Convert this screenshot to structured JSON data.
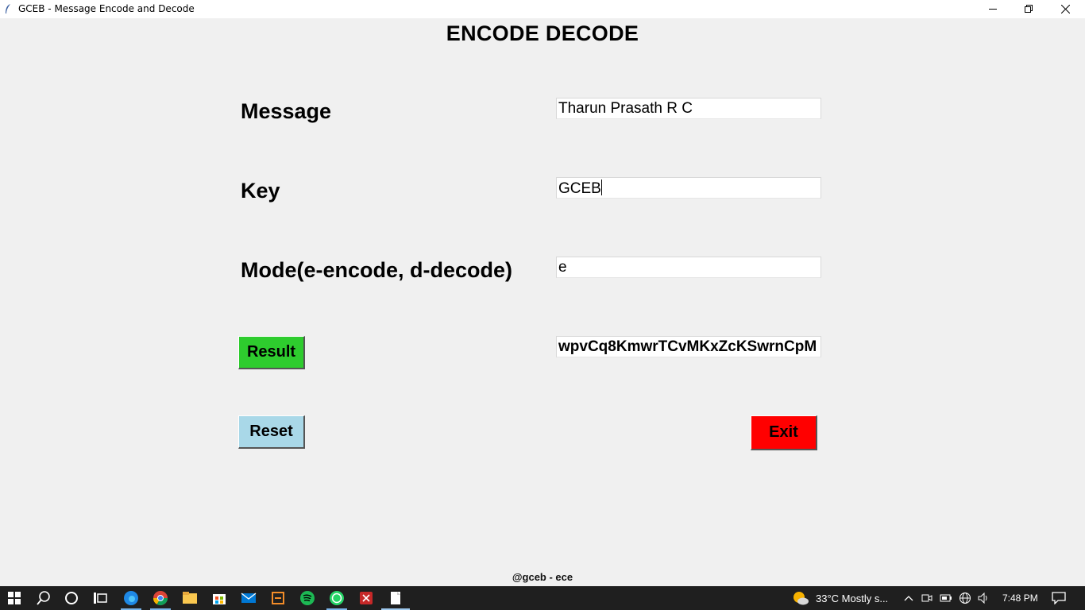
{
  "window": {
    "title": "GCEB - Message Encode and Decode"
  },
  "app": {
    "heading": "ENCODE DECODE",
    "message_label": "Message",
    "key_label": "Key",
    "mode_label": "Mode(e-encode, d-decode)",
    "message_value": "Tharun Prasath R C",
    "key_value": "GCEB",
    "mode_value": "e",
    "result_value": "wpvCq8KmwrTCvMKxZcKSwrnCpM",
    "result_button": "Result",
    "reset_button": "Reset",
    "exit_button": "Exit",
    "footer": "@gceb - ece"
  },
  "taskbar": {
    "weather": "33°C  Mostly s...",
    "time": "7:48 PM",
    "apps": [
      "start",
      "search",
      "cortana",
      "task-view",
      "edge",
      "chrome",
      "file-explorer",
      "store",
      "mail",
      "app-orange",
      "spotify",
      "whatsapp",
      "app-red",
      "notepad"
    ]
  },
  "colors": {
    "result_button": "#2ecc2e",
    "reset_button": "#a9d8e8",
    "exit_button": "#ff0000",
    "background": "#f0f0f0"
  }
}
